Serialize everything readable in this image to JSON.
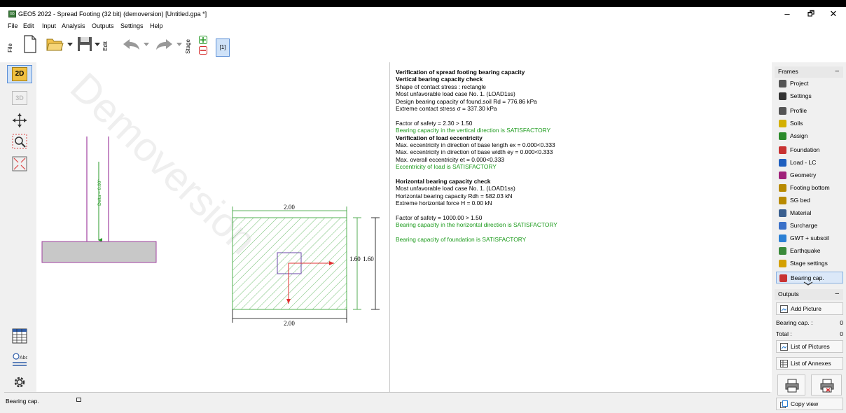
{
  "window": {
    "title": "GEO5 2022 - Spread Footing (32 bit) (demoversion) [Untitled.gpa *]",
    "minimize": "–",
    "restore": "🗗",
    "close": "✕"
  },
  "menu": [
    "File",
    "Edit",
    "Input",
    "Analysis",
    "Outputs",
    "Settings",
    "Help"
  ],
  "toolbar": {
    "file_label": "File",
    "edit_label": "Edit",
    "stage_label": "Stage",
    "stage_number": "[1]"
  },
  "left_tools": {
    "view_2d": "2D",
    "view_3d": "3D"
  },
  "drawing": {
    "watermark": "Demoversion",
    "delta_label": "Delta = 0.00°",
    "dim_top": "2.00",
    "dim_bottom": "2.00",
    "dim_right_1": "1.60",
    "dim_right_2": "1.60"
  },
  "results": {
    "lines": [
      {
        "text": "Verification of spread footing bearing capacity",
        "style": "bold"
      },
      {
        "text": "Vertical bearing capacity check",
        "style": "bold"
      },
      {
        "text": "Shape of contact stress : rectangle",
        "style": "normal"
      },
      {
        "text": "Most unfavorable load case No. 1. (LOAD1ss)",
        "style": "normal"
      },
      {
        "text": "Design bearing capacity of found.soil  Rd  =  776.86  kPa",
        "style": "normal"
      },
      {
        "text": "Extreme contact stress                        σ   =  337.30  kPa",
        "style": "normal"
      },
      {
        "text": "",
        "style": "normal"
      },
      {
        "text": "Factor of safety = 2.30 > 1.50",
        "style": "normal"
      },
      {
        "text": "Bearing capacity in the vertical direction is SATISFACTORY",
        "style": "green"
      },
      {
        "text": "Verification of load eccentricity",
        "style": "bold"
      },
      {
        "text": "Max. eccentricity in direction of base length  ex  =  0.000<0.333",
        "style": "normal"
      },
      {
        "text": "Max. eccentricity in direction of base width   ey  =  0.000<0.333",
        "style": "normal"
      },
      {
        "text": "Max. overall eccentricity                              et  =  0.000<0.333",
        "style": "normal"
      },
      {
        "text": "Eccentricity of load is SATISFACTORY",
        "style": "green"
      },
      {
        "text": "",
        "style": "normal"
      },
      {
        "text": "Horizontal bearing capacity check",
        "style": "bold"
      },
      {
        "text": "Most unfavorable load case No. 1. (LOAD1ss)",
        "style": "normal"
      },
      {
        "text": "Horizontal bearing capacity  Rdh  =  582.03  kN",
        "style": "normal"
      },
      {
        "text": "Extreme horizontal force     H    =     0.00  kN",
        "style": "normal"
      },
      {
        "text": "",
        "style": "normal"
      },
      {
        "text": "Factor of safety = 1000.00 > 1.50",
        "style": "normal"
      },
      {
        "text": "Bearing capacity in the horizontal direction is SATISFACTORY",
        "style": "green"
      },
      {
        "text": "",
        "style": "normal"
      },
      {
        "text": "Bearing capacity of foundation is SATISFACTORY",
        "style": "green"
      }
    ]
  },
  "frames": {
    "header": "Frames",
    "items": [
      {
        "label": "Project",
        "icon": "project-icon",
        "color": "#555555"
      },
      {
        "label": "Settings",
        "icon": "gear-icon",
        "color": "#333333"
      },
      {
        "label": "Profile",
        "icon": "profile-icon",
        "color": "#555555"
      },
      {
        "label": "Soils",
        "icon": "soils-icon",
        "color": "#d4b000"
      },
      {
        "label": "Assign",
        "icon": "assign-icon",
        "color": "#2a8a2a"
      },
      {
        "label": "Foundation",
        "icon": "foundation-icon",
        "color": "#c83232"
      },
      {
        "label": "Load - LC",
        "icon": "load-icon",
        "color": "#1f5fbf"
      },
      {
        "label": "Geometry",
        "icon": "geometry-icon",
        "color": "#a0207a"
      },
      {
        "label": "Footing bottom",
        "icon": "footing-bottom-icon",
        "color": "#b88a00"
      },
      {
        "label": "SG bed",
        "icon": "sg-bed-icon",
        "color": "#b88a00"
      },
      {
        "label": "Material",
        "icon": "material-icon",
        "color": "#3a5f8f"
      },
      {
        "label": "Surcharge",
        "icon": "surcharge-icon",
        "color": "#3a70c8"
      },
      {
        "label": "GWT + subsoil",
        "icon": "gwt-icon",
        "color": "#2a7fd4"
      },
      {
        "label": "Earthquake",
        "icon": "earthquake-icon",
        "color": "#3a8a3a"
      },
      {
        "label": "Stage settings",
        "icon": "stage-settings-icon",
        "color": "#d4a000"
      },
      {
        "label": "Bearing cap.",
        "icon": "bearing-cap-icon",
        "color": "#c83232"
      }
    ],
    "selected": "Bearing cap."
  },
  "outputs": {
    "header": "Outputs",
    "add_picture": "Add Picture",
    "bearing_label": "Bearing cap. :",
    "bearing_count": "0",
    "total_label": "Total :",
    "total_count": "0",
    "list_pictures": "List of Pictures",
    "list_annexes": "List of Annexes",
    "copy_view": "Copy view"
  },
  "status": {
    "text": "Bearing cap."
  },
  "colors": {
    "accent": "#1a9a1a",
    "selected": "#dbe8f8",
    "footing_fill": "#c8c8c8",
    "footing_border": "#a040a0",
    "hatch": "#50b050",
    "arrow": "#e03030"
  }
}
